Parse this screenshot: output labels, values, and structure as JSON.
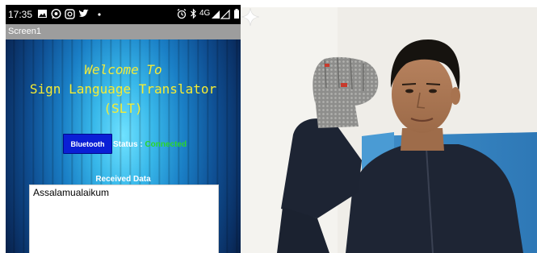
{
  "status_bar": {
    "time": "17:35",
    "left_icons": [
      "image-icon",
      "whatsapp-icon",
      "instagram-icon",
      "twitter-icon",
      "dot-icon"
    ],
    "right_icons": [
      "alarm-icon",
      "bluetooth-icon",
      "signal-icon",
      "battery-icon"
    ],
    "network": "4G"
  },
  "app": {
    "screen_title": "Screen1",
    "welcome_text": "Welcome To",
    "title_line1": "Sign Language Translator",
    "title_line2": "(SLT)",
    "bluetooth_button_label": "Bluetooth",
    "status_label": "Status :",
    "status_value": "Connected",
    "received_label": "Received Data",
    "received_text": "Assalamualaikum"
  },
  "photo": {
    "icon": "sparkle-icon"
  },
  "colors": {
    "title_yellow": "#f6ec33",
    "button_blue": "#0a1fd6",
    "status_green": "#2bd62b",
    "titlebar_gray": "#9d9d9d"
  }
}
